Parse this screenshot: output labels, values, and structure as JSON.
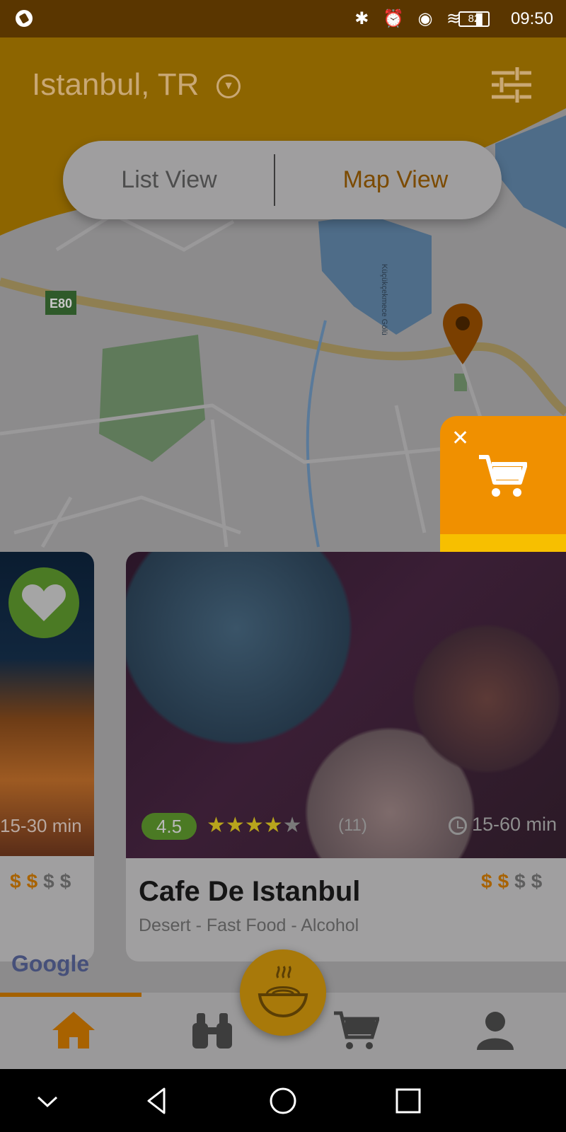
{
  "status_bar": {
    "time": "09:50",
    "battery": "82",
    "icons": [
      "whatsapp-icon",
      "bluetooth-icon",
      "alarm-icon",
      "eye-icon",
      "wifi-icon",
      "signal-icon",
      "battery-icon"
    ]
  },
  "header": {
    "city": "Istanbul, TR",
    "chevron_icon": "chevron-down-circle-icon",
    "filter_icon": "sliders-icon"
  },
  "view_toggle": {
    "list_label": "List View",
    "map_label": "Map View",
    "active": "Map View"
  },
  "map": {
    "road_label": "E80",
    "lake_label": "Küçükçekmece Gölü",
    "attribution": "Google"
  },
  "quick_actions": {
    "close_icon": "close-icon",
    "cart_icon": "cart-icon",
    "contact_icon": "contact-phone-icon"
  },
  "cards": [
    {
      "time": "15-30 min",
      "price_level": 2,
      "price_max": 4,
      "price_symbols": [
        "$",
        "$",
        "$",
        "$"
      ],
      "favorite_icon": "heart-icon"
    },
    {
      "name": "Cafe De Istanbul",
      "cuisine": "Desert - Fast Food - Alcohol",
      "rating": "4.5",
      "stars": 4.5,
      "review_count": "(11)",
      "time": "15-60 min",
      "price_level": 2,
      "price_max": 4,
      "price_symbols": [
        "$",
        "$",
        "$",
        "$"
      ]
    }
  ],
  "bottom_nav": {
    "items": [
      {
        "icon": "home-icon",
        "active": true
      },
      {
        "icon": "binoculars-icon",
        "active": false
      },
      {
        "icon": "noodle-bowl-icon",
        "active": false
      },
      {
        "icon": "cart-icon",
        "active": false
      },
      {
        "icon": "profile-icon",
        "active": false
      }
    ]
  },
  "system_nav": [
    "collapse-icon",
    "back-icon",
    "home-circle-icon",
    "recents-icon"
  ],
  "colors": {
    "accent": "#F7A500",
    "primary_orange": "#F09000",
    "secondary_yellow": "#F7BF00",
    "rating_green": "#4B7A24",
    "overlay": "rgba(0,0,0,0.38)"
  }
}
